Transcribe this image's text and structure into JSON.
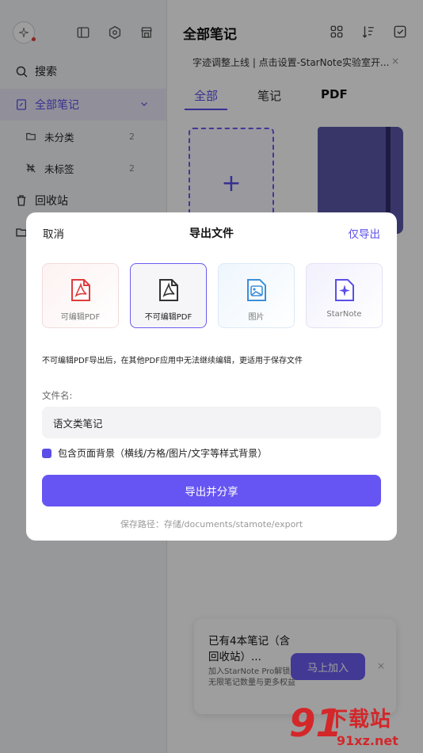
{
  "sidebar": {
    "search_label": "搜索",
    "all_notes_label": "全部笔记",
    "uncategorized_label": "未分类",
    "uncategorized_count": "2",
    "untagged_label": "未标签",
    "untagged_count": "2",
    "trash_label": "回收站"
  },
  "main": {
    "title": "全部笔记",
    "notice": "字迹调整上线 | 点击设置-StarNote实验室开...",
    "notice_close": "×",
    "tabs": [
      {
        "label": "全部"
      },
      {
        "label": "笔记"
      },
      {
        "label": "PDF"
      }
    ],
    "new_card_plus": "+"
  },
  "promo": {
    "title": "已有4本笔记（含回收站）...",
    "description": "加入StarNote Pro解锁无限笔记数量与更多权益",
    "button_label": "马上加入",
    "close": "×"
  },
  "dialog": {
    "cancel_label": "取消",
    "title": "导出文件",
    "export_only_label": "仅导出",
    "options": [
      {
        "label": "可编辑PDF",
        "icon": "pdf-icon"
      },
      {
        "label": "不可编辑PDF",
        "icon": "pdf-icon"
      },
      {
        "label": "图片",
        "icon": "image-icon"
      },
      {
        "label": "StarNote",
        "icon": "sparkle-icon"
      }
    ],
    "selected_option": "不可编辑PDF",
    "description": "不可编辑PDF导出后，在其他PDF应用中无法继续编辑，更适用于保存文件",
    "filename_label": "文件名:",
    "filename_value": "语文类笔记",
    "checkbox_label": "包含页面背景（横线/方格/图片/文字等样式背景）",
    "checkbox_checked": true,
    "share_button_label": "导出并分享",
    "save_path": "保存路径：存储/documents/stamote/export"
  },
  "watermark": {
    "top": "下载站",
    "bottom": "91xz.net",
    "number": "91"
  },
  "colors": {
    "accent": "#5b4ee8",
    "pdf_red": "#e23b3b",
    "image_blue": "#3a8fd8"
  }
}
